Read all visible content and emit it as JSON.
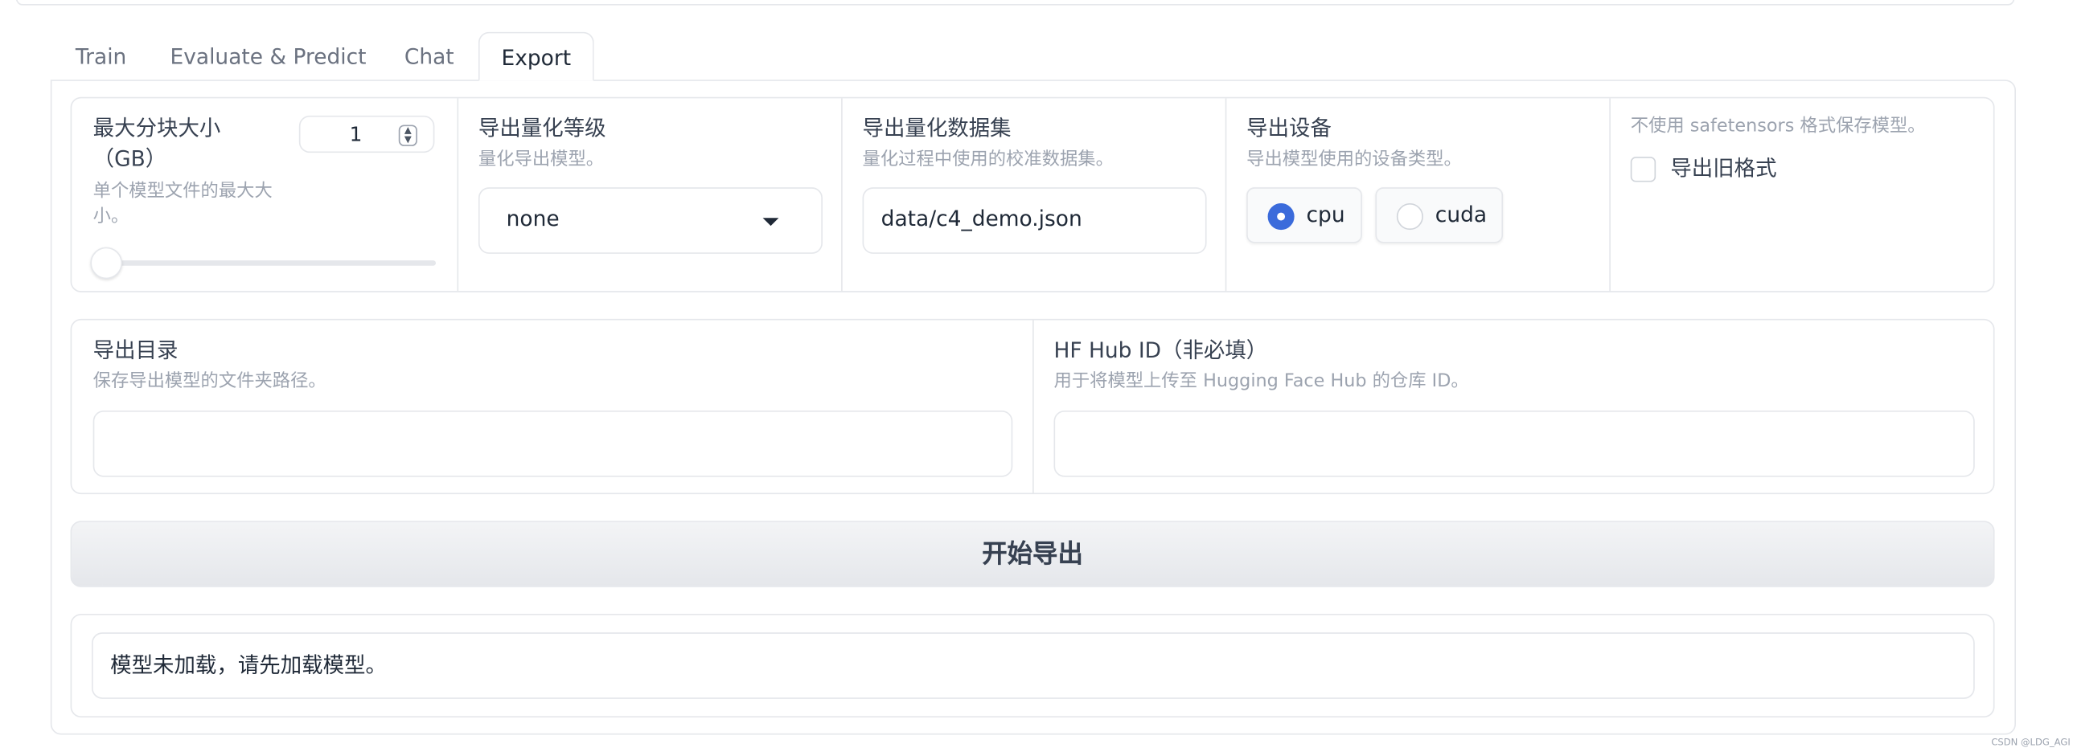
{
  "tabs": [
    {
      "label": "Train",
      "active": false
    },
    {
      "label": "Evaluate & Predict",
      "active": false
    },
    {
      "label": "Chat",
      "active": false
    },
    {
      "label": "Export",
      "active": true
    }
  ],
  "export": {
    "max_shard": {
      "label_line1": "最大分块大小",
      "label_line2": "（GB）",
      "info_line1": "单个模型文件的最大大",
      "info_line2": "小。",
      "value": "1",
      "slider_fraction": 0
    },
    "quant_bit": {
      "label": "导出量化等级",
      "info": "量化导出模型。",
      "selected": "none"
    },
    "quant_dataset": {
      "label": "导出量化数据集",
      "info": "量化过程中使用的校准数据集。",
      "value": "data/c4_demo.json"
    },
    "device": {
      "label": "导出设备",
      "info": "导出模型使用的设备类型。",
      "options": [
        "cpu",
        "cuda"
      ],
      "selected": "cpu"
    },
    "legacy_format": {
      "info": "不使用 safetensors 格式保存模型。",
      "label": "导出旧格式",
      "checked": false
    },
    "export_dir": {
      "label": "导出目录",
      "info": "保存导出模型的文件夹路径。",
      "value": ""
    },
    "hub_id": {
      "label": "HF Hub ID（非必填）",
      "info": "用于将模型上传至 Hugging Face Hub 的仓库 ID。",
      "value": ""
    },
    "start_button_label": "开始导出",
    "status_text": "模型未加载，请先加载模型。"
  },
  "watermark": "CSDN @LDG_AGI",
  "colors": {
    "accent": "#3b6bdb",
    "border": "#e5e7eb",
    "muted_text": "#9ca3af",
    "button_bg": "#e5e7eb"
  }
}
